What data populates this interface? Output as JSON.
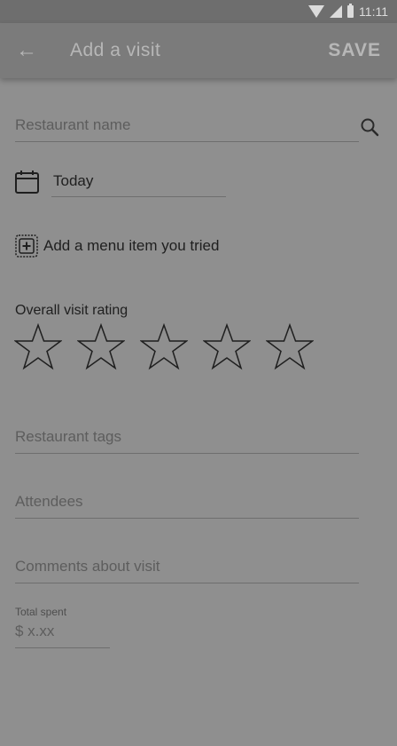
{
  "status_bar": {
    "time": "11:11",
    "icons": [
      "wifi-icon",
      "cell-signal-icon",
      "battery-icon"
    ]
  },
  "app_bar": {
    "back_icon": "back-arrow-icon",
    "title": "Add a visit",
    "save_label": "SAVE"
  },
  "form": {
    "restaurant_name": {
      "placeholder": "Restaurant name",
      "icon": "search-icon"
    },
    "date": {
      "icon": "calendar-icon",
      "value": "Today"
    },
    "menu_item": {
      "icon": "add-box-icon",
      "label": "Add a menu item you tried"
    },
    "rating": {
      "label": "Overall visit rating",
      "max_stars": 5,
      "selected": 0
    },
    "tags": {
      "placeholder": "Restaurant tags"
    },
    "attendees": {
      "placeholder": "Attendees"
    },
    "comments": {
      "placeholder": "Comments about visit"
    },
    "total_spent": {
      "label": "Total spent",
      "placeholder": "$ x.xx"
    }
  },
  "colors": {
    "overlay": "#8f8f8f",
    "app_bar": "#7b7b7b",
    "status_bar": "#6e6e6e"
  }
}
